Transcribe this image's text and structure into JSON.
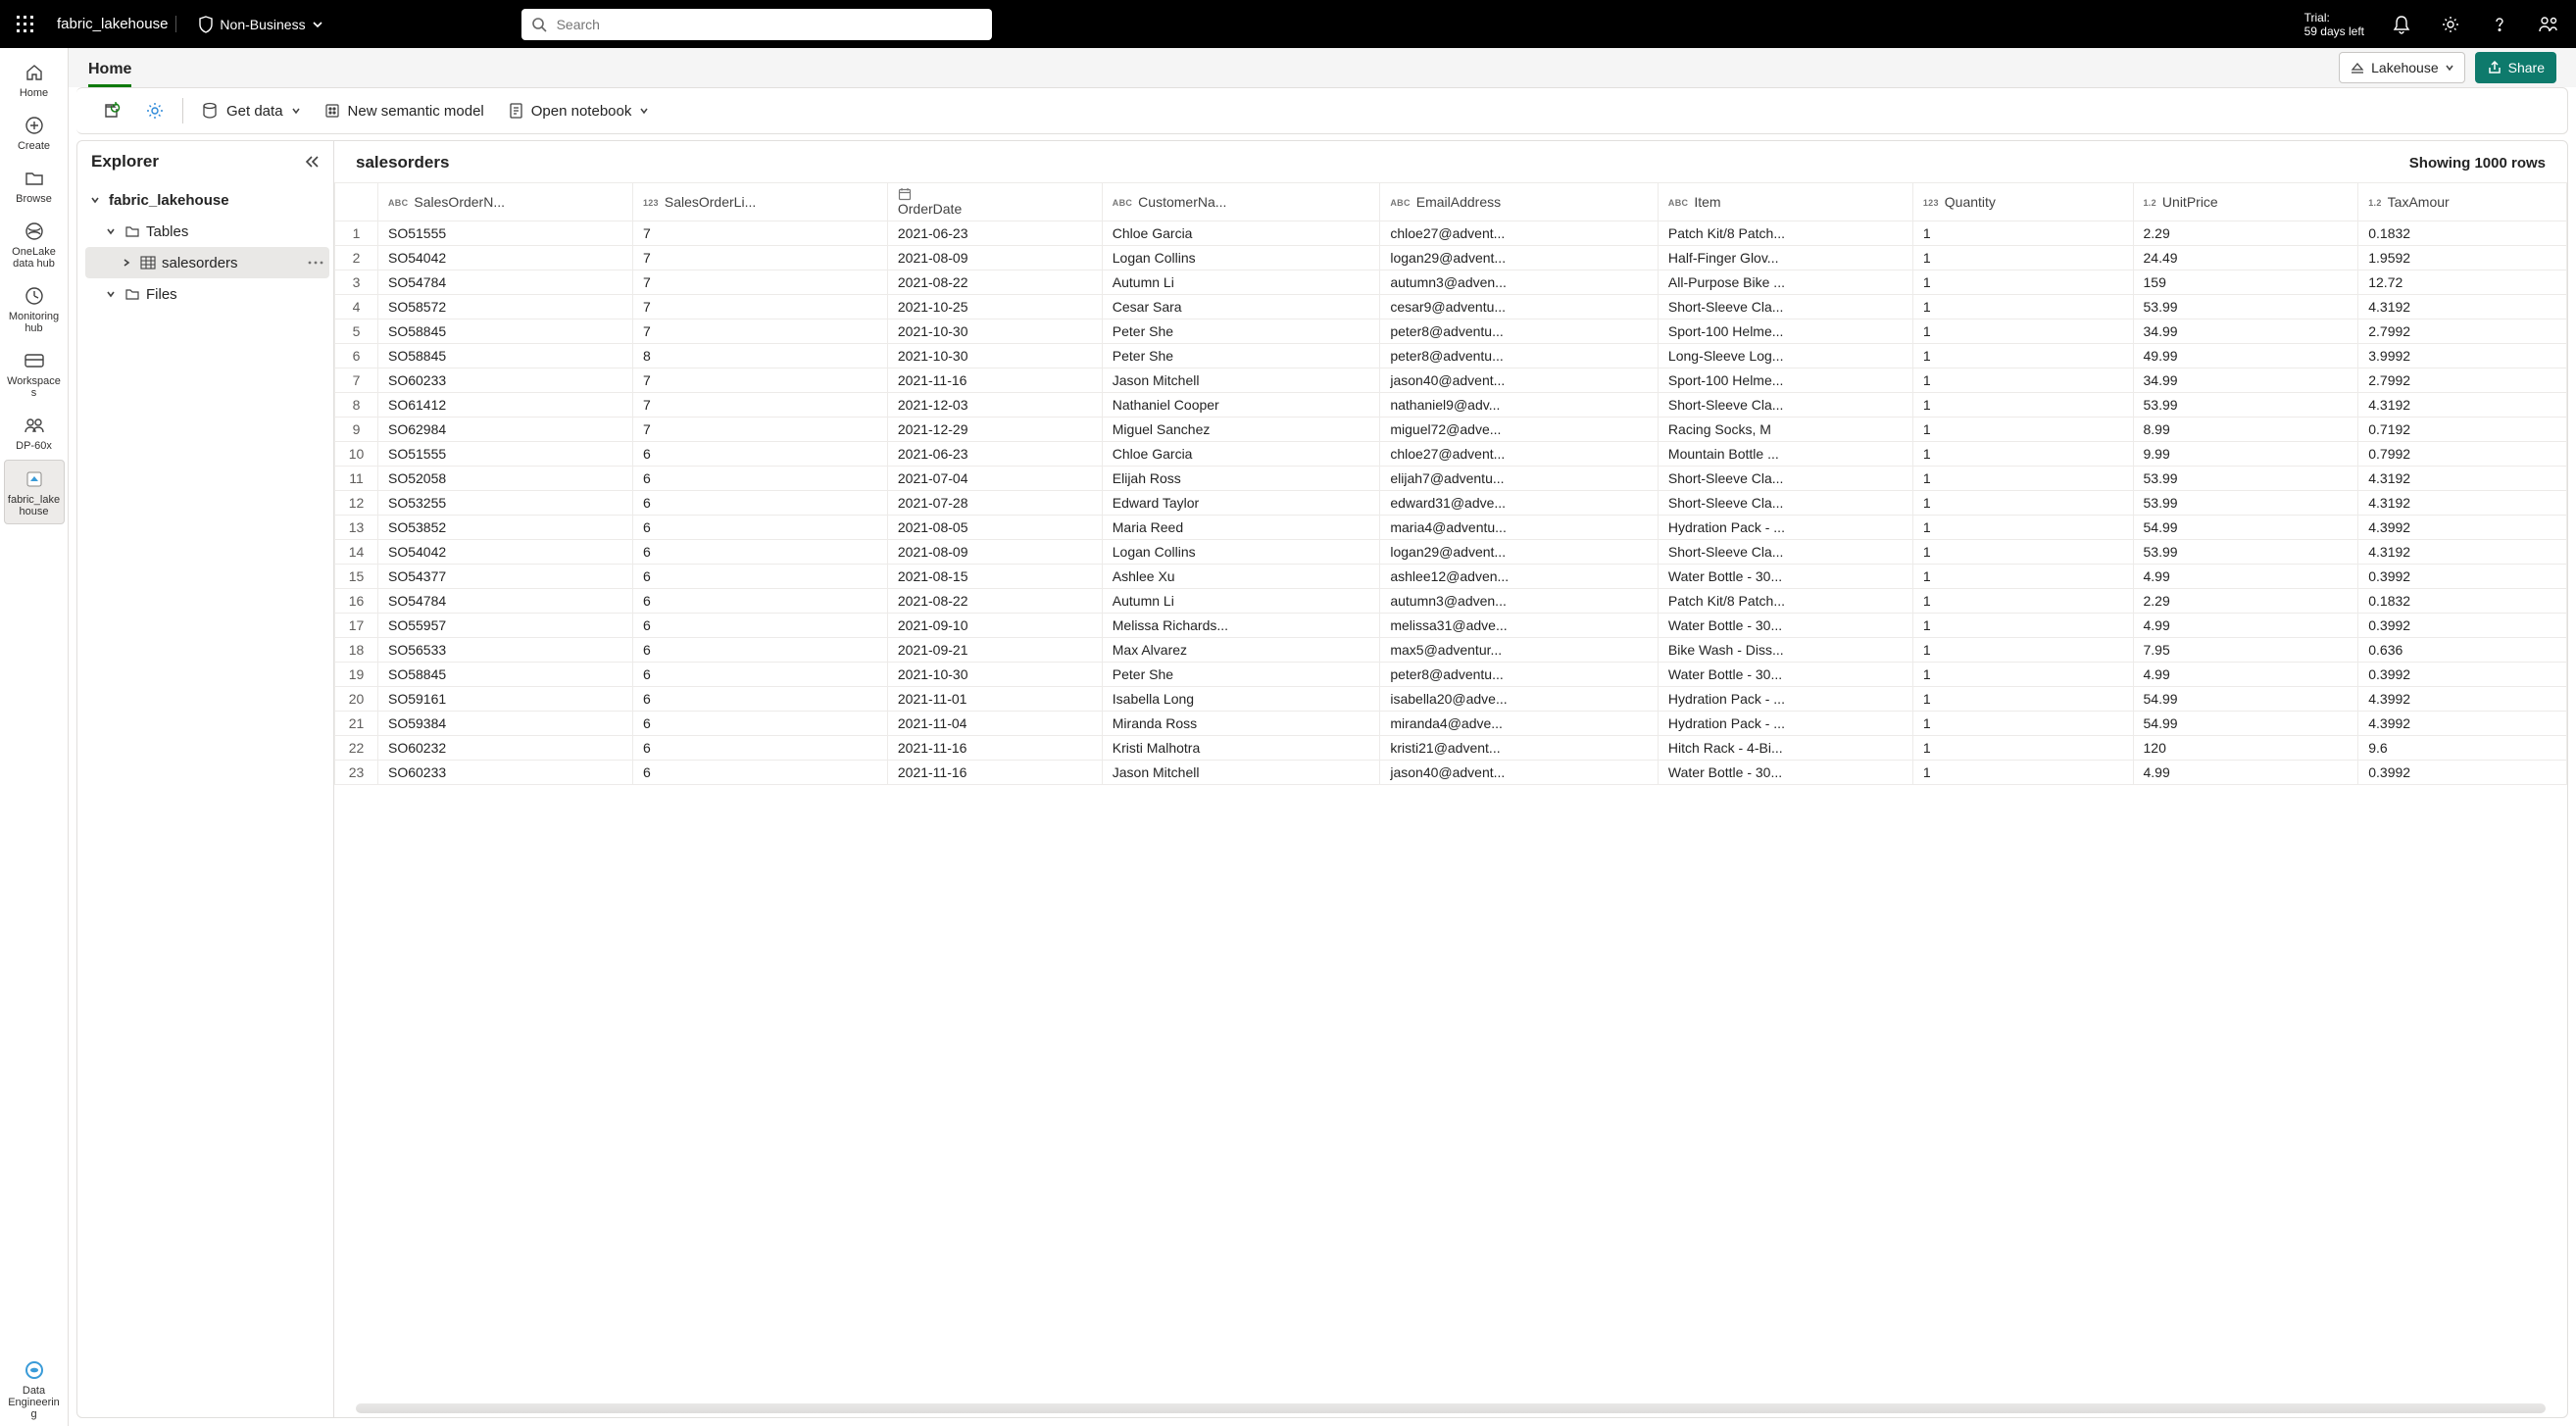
{
  "topbar": {
    "brand": "fabric_lakehouse",
    "classification": "Non-Business",
    "search_placeholder": "Search",
    "trial_line1": "Trial:",
    "trial_line2": "59 days left"
  },
  "leftrail": [
    {
      "key": "home",
      "label": "Home"
    },
    {
      "key": "create",
      "label": "Create"
    },
    {
      "key": "browse",
      "label": "Browse"
    },
    {
      "key": "onelake",
      "label": "OneLake data hub"
    },
    {
      "key": "monitoring",
      "label": "Monitoring hub"
    },
    {
      "key": "workspaces",
      "label": "Workspaces"
    },
    {
      "key": "dp60x",
      "label": "DP-60x"
    },
    {
      "key": "fabriclh",
      "label": "fabric_lakehouse",
      "active": true
    }
  ],
  "leftrail_bottom": {
    "key": "dataeng",
    "label": "Data Engineering"
  },
  "tabs": {
    "home": "Home",
    "lakehouse_pill": "Lakehouse",
    "share": "Share"
  },
  "toolbar": {
    "get_data": "Get data",
    "new_semantic_model": "New semantic model",
    "open_notebook": "Open notebook"
  },
  "explorer": {
    "title": "Explorer",
    "root": "fabric_lakehouse",
    "tables": "Tables",
    "salesorders": "salesorders",
    "files": "Files"
  },
  "grid": {
    "title": "salesorders",
    "status": "Showing 1000 rows",
    "columns": [
      {
        "type": "ABC",
        "label": "SalesOrderN...",
        "cls": "c-so"
      },
      {
        "type": "123",
        "label": "SalesOrderLi...",
        "cls": "c-line"
      },
      {
        "type": "CAL",
        "label": "OrderDate",
        "cls": "c-date"
      },
      {
        "type": "ABC",
        "label": "CustomerNa...",
        "cls": "c-cust"
      },
      {
        "type": "ABC",
        "label": "EmailAddress",
        "cls": "c-mail"
      },
      {
        "type": "ABC",
        "label": "Item",
        "cls": "c-item"
      },
      {
        "type": "123",
        "label": "Quantity",
        "cls": "c-qty"
      },
      {
        "type": "1.2",
        "label": "UnitPrice",
        "cls": "c-up"
      },
      {
        "type": "1.2",
        "label": "TaxAmour",
        "cls": "c-tax"
      }
    ],
    "rows": [
      [
        "SO51555",
        "7",
        "2021-06-23",
        "Chloe Garcia",
        "chloe27@advent...",
        "Patch Kit/8 Patch...",
        "1",
        "2.29",
        "0.1832"
      ],
      [
        "SO54042",
        "7",
        "2021-08-09",
        "Logan Collins",
        "logan29@advent...",
        "Half-Finger Glov...",
        "1",
        "24.49",
        "1.9592"
      ],
      [
        "SO54784",
        "7",
        "2021-08-22",
        "Autumn Li",
        "autumn3@adven...",
        "All-Purpose Bike ...",
        "1",
        "159",
        "12.72"
      ],
      [
        "SO58572",
        "7",
        "2021-10-25",
        "Cesar Sara",
        "cesar9@adventu...",
        "Short-Sleeve Cla...",
        "1",
        "53.99",
        "4.3192"
      ],
      [
        "SO58845",
        "7",
        "2021-10-30",
        "Peter She",
        "peter8@adventu...",
        "Sport-100 Helme...",
        "1",
        "34.99",
        "2.7992"
      ],
      [
        "SO58845",
        "8",
        "2021-10-30",
        "Peter She",
        "peter8@adventu...",
        "Long-Sleeve Log...",
        "1",
        "49.99",
        "3.9992"
      ],
      [
        "SO60233",
        "7",
        "2021-11-16",
        "Jason Mitchell",
        "jason40@advent...",
        "Sport-100 Helme...",
        "1",
        "34.99",
        "2.7992"
      ],
      [
        "SO61412",
        "7",
        "2021-12-03",
        "Nathaniel Cooper",
        "nathaniel9@adv...",
        "Short-Sleeve Cla...",
        "1",
        "53.99",
        "4.3192"
      ],
      [
        "SO62984",
        "7",
        "2021-12-29",
        "Miguel Sanchez",
        "miguel72@adve...",
        "Racing Socks, M",
        "1",
        "8.99",
        "0.7192"
      ],
      [
        "SO51555",
        "6",
        "2021-06-23",
        "Chloe Garcia",
        "chloe27@advent...",
        "Mountain Bottle ...",
        "1",
        "9.99",
        "0.7992"
      ],
      [
        "SO52058",
        "6",
        "2021-07-04",
        "Elijah Ross",
        "elijah7@adventu...",
        "Short-Sleeve Cla...",
        "1",
        "53.99",
        "4.3192"
      ],
      [
        "SO53255",
        "6",
        "2021-07-28",
        "Edward Taylor",
        "edward31@adve...",
        "Short-Sleeve Cla...",
        "1",
        "53.99",
        "4.3192"
      ],
      [
        "SO53852",
        "6",
        "2021-08-05",
        "Maria Reed",
        "maria4@adventu...",
        "Hydration Pack - ...",
        "1",
        "54.99",
        "4.3992"
      ],
      [
        "SO54042",
        "6",
        "2021-08-09",
        "Logan Collins",
        "logan29@advent...",
        "Short-Sleeve Cla...",
        "1",
        "53.99",
        "4.3192"
      ],
      [
        "SO54377",
        "6",
        "2021-08-15",
        "Ashlee Xu",
        "ashlee12@adven...",
        "Water Bottle - 30...",
        "1",
        "4.99",
        "0.3992"
      ],
      [
        "SO54784",
        "6",
        "2021-08-22",
        "Autumn Li",
        "autumn3@adven...",
        "Patch Kit/8 Patch...",
        "1",
        "2.29",
        "0.1832"
      ],
      [
        "SO55957",
        "6",
        "2021-09-10",
        "Melissa Richards...",
        "melissa31@adve...",
        "Water Bottle - 30...",
        "1",
        "4.99",
        "0.3992"
      ],
      [
        "SO56533",
        "6",
        "2021-09-21",
        "Max Alvarez",
        "max5@adventur...",
        "Bike Wash - Diss...",
        "1",
        "7.95",
        "0.636"
      ],
      [
        "SO58845",
        "6",
        "2021-10-30",
        "Peter She",
        "peter8@adventu...",
        "Water Bottle - 30...",
        "1",
        "4.99",
        "0.3992"
      ],
      [
        "SO59161",
        "6",
        "2021-11-01",
        "Isabella Long",
        "isabella20@adve...",
        "Hydration Pack - ...",
        "1",
        "54.99",
        "4.3992"
      ],
      [
        "SO59384",
        "6",
        "2021-11-04",
        "Miranda Ross",
        "miranda4@adve...",
        "Hydration Pack - ...",
        "1",
        "54.99",
        "4.3992"
      ],
      [
        "SO60232",
        "6",
        "2021-11-16",
        "Kristi Malhotra",
        "kristi21@advent...",
        "Hitch Rack - 4-Bi...",
        "1",
        "120",
        "9.6"
      ],
      [
        "SO60233",
        "6",
        "2021-11-16",
        "Jason Mitchell",
        "jason40@advent...",
        "Water Bottle - 30...",
        "1",
        "4.99",
        "0.3992"
      ]
    ]
  }
}
